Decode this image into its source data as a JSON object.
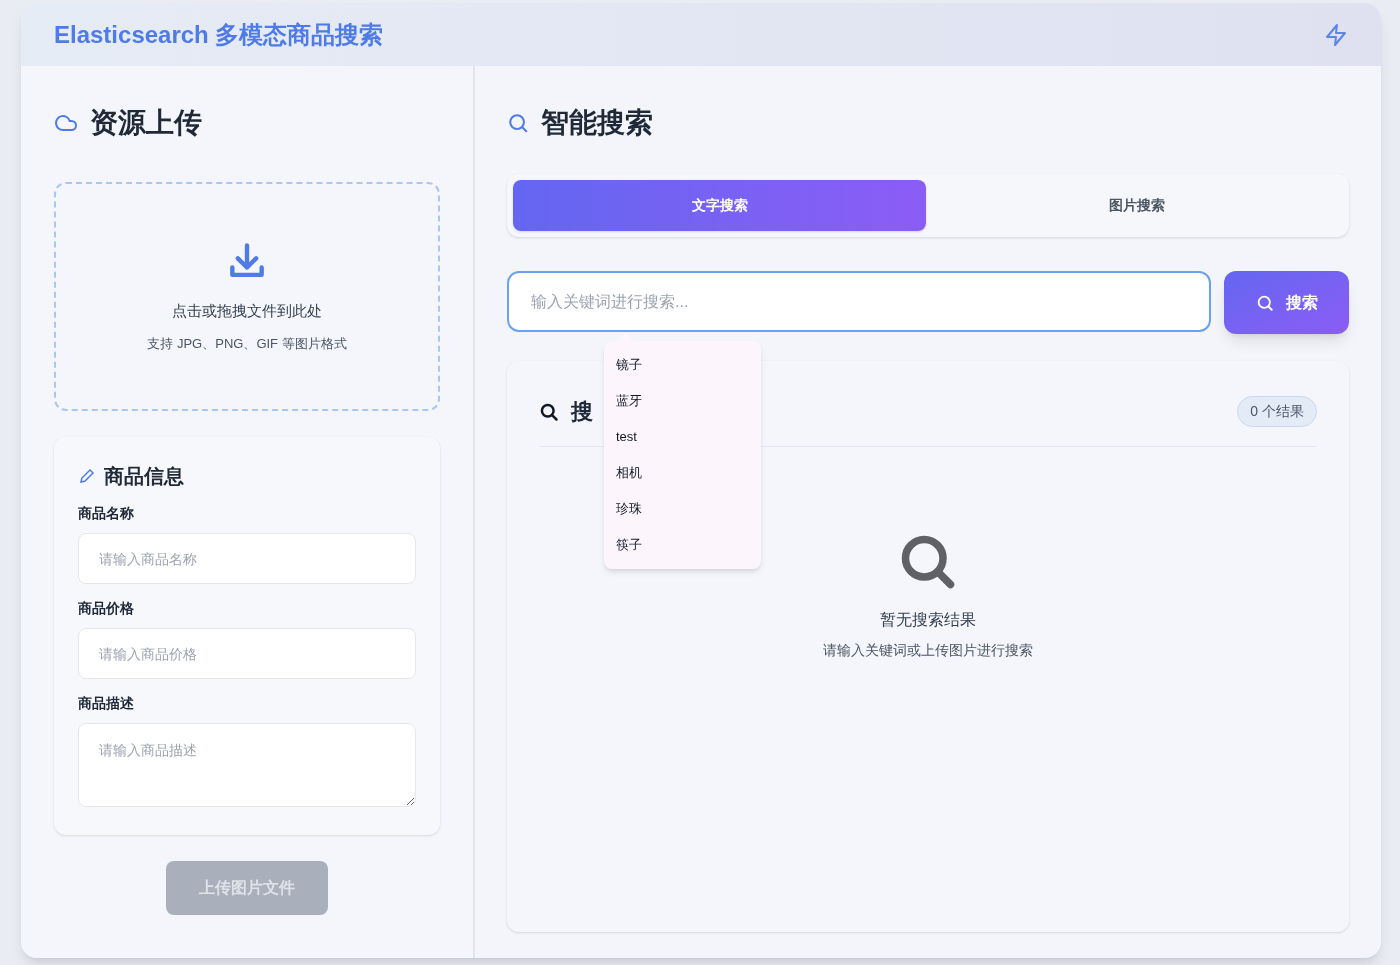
{
  "header": {
    "title": "Elasticsearch 多模态商品搜索"
  },
  "upload_panel": {
    "title": "资源上传",
    "dropzone": {
      "text": "点击或拖拽文件到此处",
      "hint": "支持 JPG、PNG、GIF 等图片格式"
    },
    "product_info": {
      "title": "商品信息",
      "fields": [
        {
          "label": "商品名称",
          "placeholder": "请输入商品名称",
          "kind": "input"
        },
        {
          "label": "商品价格",
          "placeholder": "请输入商品价格",
          "kind": "input"
        },
        {
          "label": "商品描述",
          "placeholder": "请输入商品描述",
          "kind": "textarea"
        }
      ]
    },
    "upload_button": {
      "label": "上传图片文件",
      "disabled": true
    }
  },
  "search_panel": {
    "title": "智能搜索",
    "tabs": [
      {
        "label": "文字搜索",
        "selected": true
      },
      {
        "label": "图片搜索",
        "selected": false
      }
    ],
    "search_field": {
      "placeholder": "输入关键词进行搜索..."
    },
    "search_button": {
      "label": "搜索"
    },
    "suggestions": [
      "镜子",
      "蓝牙",
      "test",
      "相机",
      "珍珠",
      "筷子"
    ],
    "results": {
      "title": "搜",
      "count": "0 个结果",
      "empty_title": "暂无搜索结果",
      "empty_hint": "请输入关键词或上传图片进行搜索"
    }
  }
}
